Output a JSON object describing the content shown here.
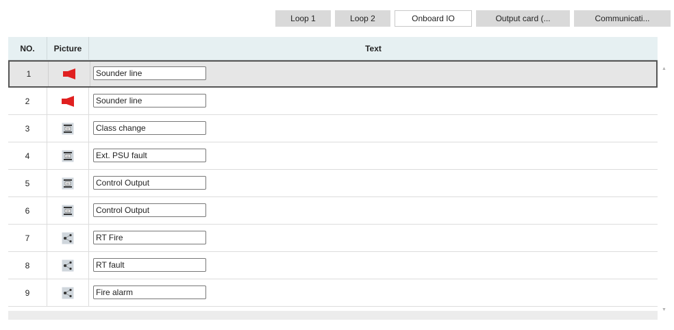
{
  "tabs": [
    {
      "label": "Loop 1",
      "active": false
    },
    {
      "label": "Loop 2",
      "active": false
    },
    {
      "label": "Onboard IO",
      "active": true
    },
    {
      "label": "Output card (...",
      "active": false
    },
    {
      "label": "Communicati...",
      "active": false
    }
  ],
  "grid": {
    "headers": {
      "no": "NO.",
      "picture": "Picture",
      "text": "Text"
    },
    "rows": [
      {
        "no": "1",
        "icon": "sounder-icon",
        "text": "Sounder line",
        "selected": true
      },
      {
        "no": "2",
        "icon": "sounder-icon",
        "text": "Sounder line",
        "selected": false
      },
      {
        "no": "3",
        "icon": "io-module-icon",
        "text": "Class change",
        "selected": false
      },
      {
        "no": "4",
        "icon": "io-module-icon",
        "text": "Ext. PSU fault",
        "selected": false
      },
      {
        "no": "5",
        "icon": "io-module-icon",
        "text": "Control Output",
        "selected": false
      },
      {
        "no": "6",
        "icon": "io-module-icon",
        "text": "Control Output",
        "selected": false
      },
      {
        "no": "7",
        "icon": "routing-icon",
        "text": "RT Fire",
        "selected": false
      },
      {
        "no": "8",
        "icon": "routing-icon",
        "text": "RT fault",
        "selected": false
      },
      {
        "no": "9",
        "icon": "routing-icon",
        "text": "Fire alarm",
        "selected": false
      }
    ]
  },
  "colors": {
    "sounder": "#e02020",
    "header_bg": "#e6f0f2",
    "tab_bg": "#d9d9d9",
    "selected_row": "#e6e6e6"
  }
}
